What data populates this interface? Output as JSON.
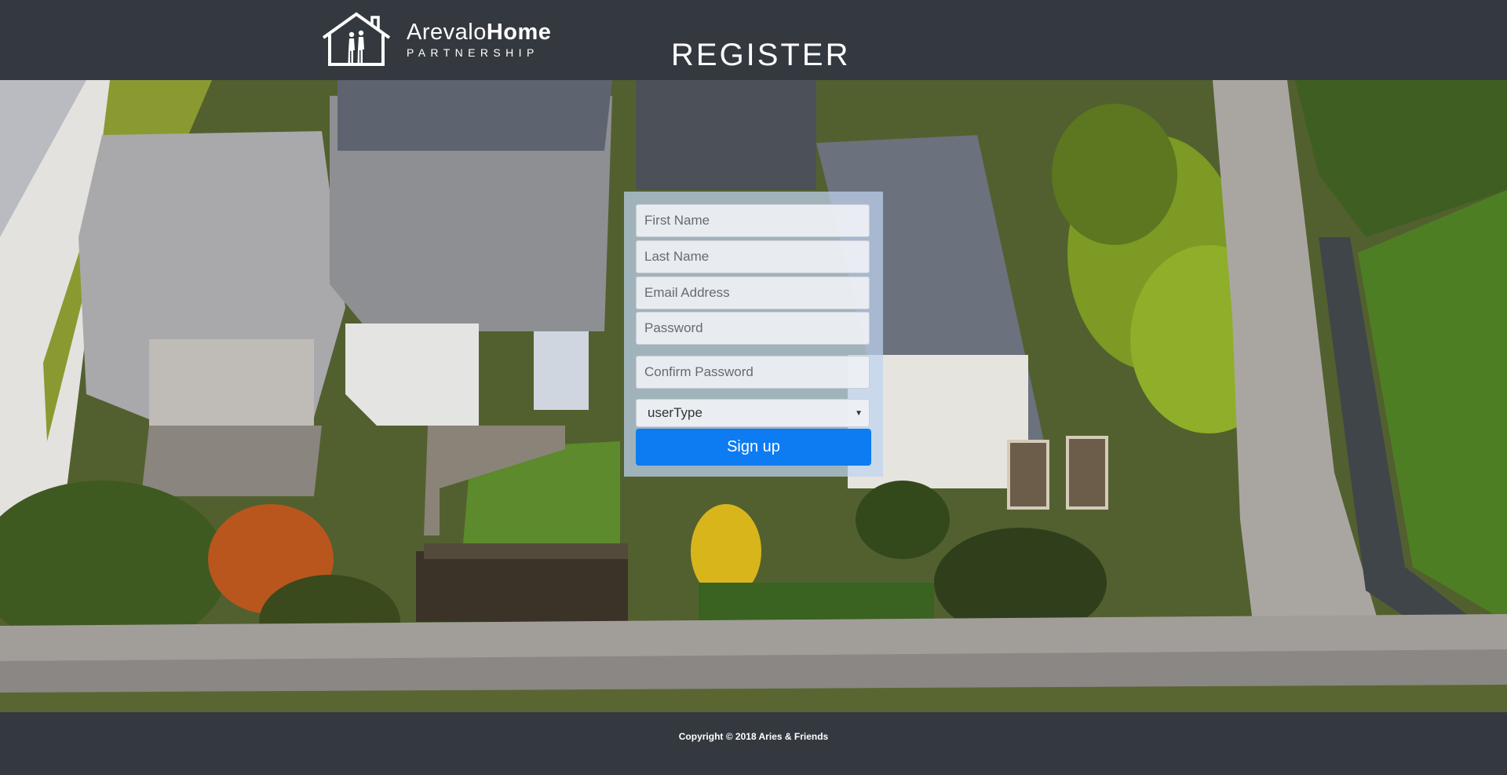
{
  "header": {
    "logo": {
      "name_light": "Arevalo",
      "name_bold": "Home",
      "tagline": "PARTNERSHIP",
      "icon": "house-couple-icon"
    },
    "title": "REGISTER"
  },
  "form": {
    "first_name": {
      "placeholder": "First Name",
      "value": ""
    },
    "last_name": {
      "placeholder": "Last Name",
      "value": ""
    },
    "email": {
      "placeholder": "Email Address",
      "value": ""
    },
    "password": {
      "placeholder": "Password",
      "value": ""
    },
    "confirm_password": {
      "placeholder": "Confirm Password",
      "value": ""
    },
    "user_type": {
      "selected": "userType",
      "arrow": "▼"
    },
    "submit_label": "Sign up"
  },
  "footer": {
    "copyright": "Copyright © 2018 Aries & Friends"
  },
  "colors": {
    "header_bg": "#343940",
    "primary_button": "#0d7cf2",
    "form_panel": "#bed2f0"
  }
}
